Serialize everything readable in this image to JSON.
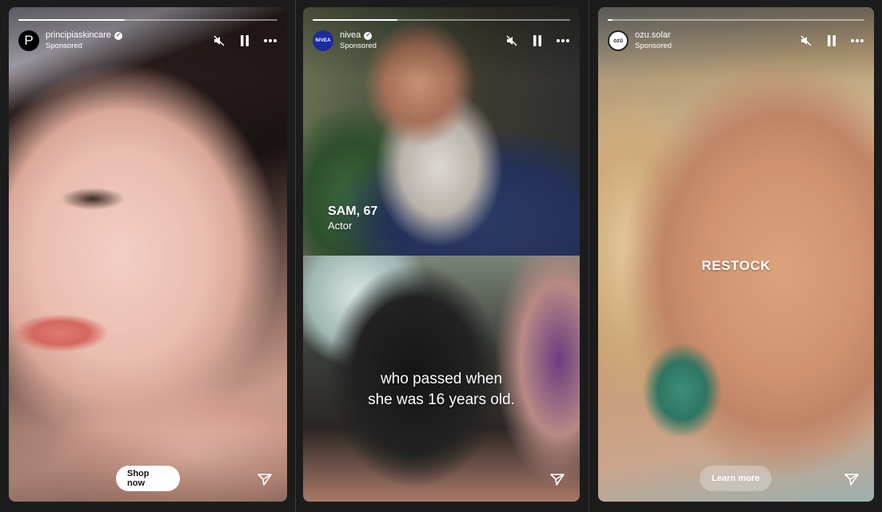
{
  "stories": [
    {
      "account": "principiaskincare",
      "avatar_text": "P",
      "verified": true,
      "label": "Sponsored",
      "progress": 0.41,
      "overlay": [],
      "cta": "Shop now",
      "cta_style": "white"
    },
    {
      "account": "nivea",
      "avatar_text": "NIVEA",
      "verified": true,
      "label": "Sponsored",
      "progress": 0.33,
      "overlay": {
        "name": "SAM, 67",
        "role": "Actor",
        "caption_line1": "who passed when",
        "caption_line2": "she was 16 years old."
      },
      "cta": null
    },
    {
      "account": "ozu.solar",
      "avatar_text": "ozü",
      "verified": false,
      "label": "Sponsored",
      "progress": 0.02,
      "overlay": {
        "headline": "RESTOCK"
      },
      "cta": "Learn more",
      "cta_style": "ghost"
    }
  ],
  "icons": {
    "mute": "speaker-muted-icon",
    "pause": "pause-icon",
    "more": "more-horizontal-icon",
    "share": "paper-plane-icon",
    "verified": "verified-badge-icon"
  },
  "colors": {
    "background": "#1c1c1c",
    "nivea_blue": "#1d2aa3"
  }
}
